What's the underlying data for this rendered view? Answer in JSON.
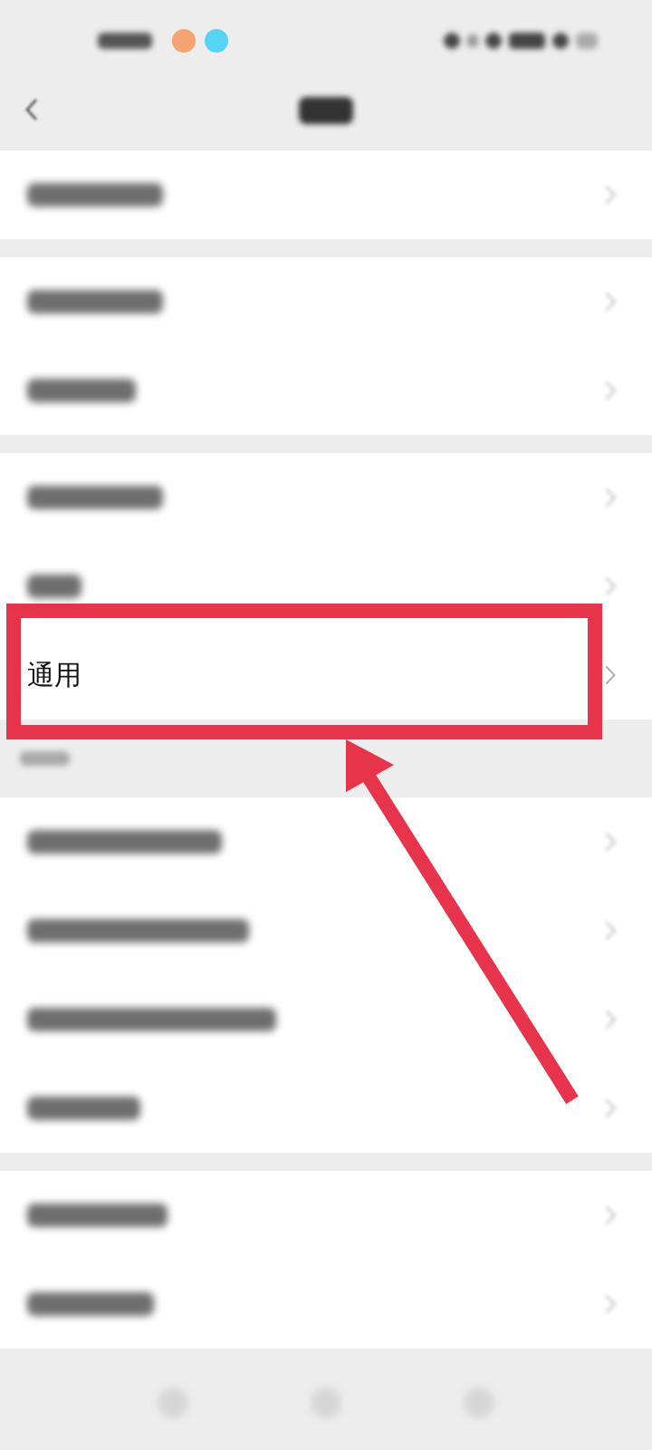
{
  "status_bar": {
    "notification_icons": [
      {
        "color": "#f5a46f"
      },
      {
        "color": "#56d4f2"
      }
    ]
  },
  "header": {
    "title": {
      "kind": "blurred"
    }
  },
  "groups": [
    {
      "rows": [
        {
          "kind": "blurred",
          "highlighted": false
        }
      ]
    },
    {
      "rows": [
        {
          "kind": "blurred",
          "highlighted": false
        },
        {
          "kind": "blurred",
          "highlighted": false
        }
      ]
    },
    {
      "rows": [
        {
          "kind": "blurred",
          "highlighted": false
        },
        {
          "kind": "blurred",
          "highlighted": false
        },
        {
          "kind": "text",
          "label": "通用",
          "highlighted": true
        }
      ]
    },
    {
      "section_title": {
        "kind": "blurred"
      },
      "rows": [
        {
          "kind": "blurred",
          "highlighted": false
        },
        {
          "kind": "blurred",
          "highlighted": false
        },
        {
          "kind": "blurred",
          "highlighted": false
        },
        {
          "kind": "blurred",
          "highlighted": false
        }
      ]
    },
    {
      "rows": [
        {
          "kind": "blurred",
          "highlighted": false
        },
        {
          "kind": "blurred",
          "highlighted": false
        }
      ]
    }
  ],
  "bottom_nav": [
    {
      "kind": "blurred"
    },
    {
      "kind": "blurred"
    },
    {
      "kind": "blurred"
    }
  ]
}
